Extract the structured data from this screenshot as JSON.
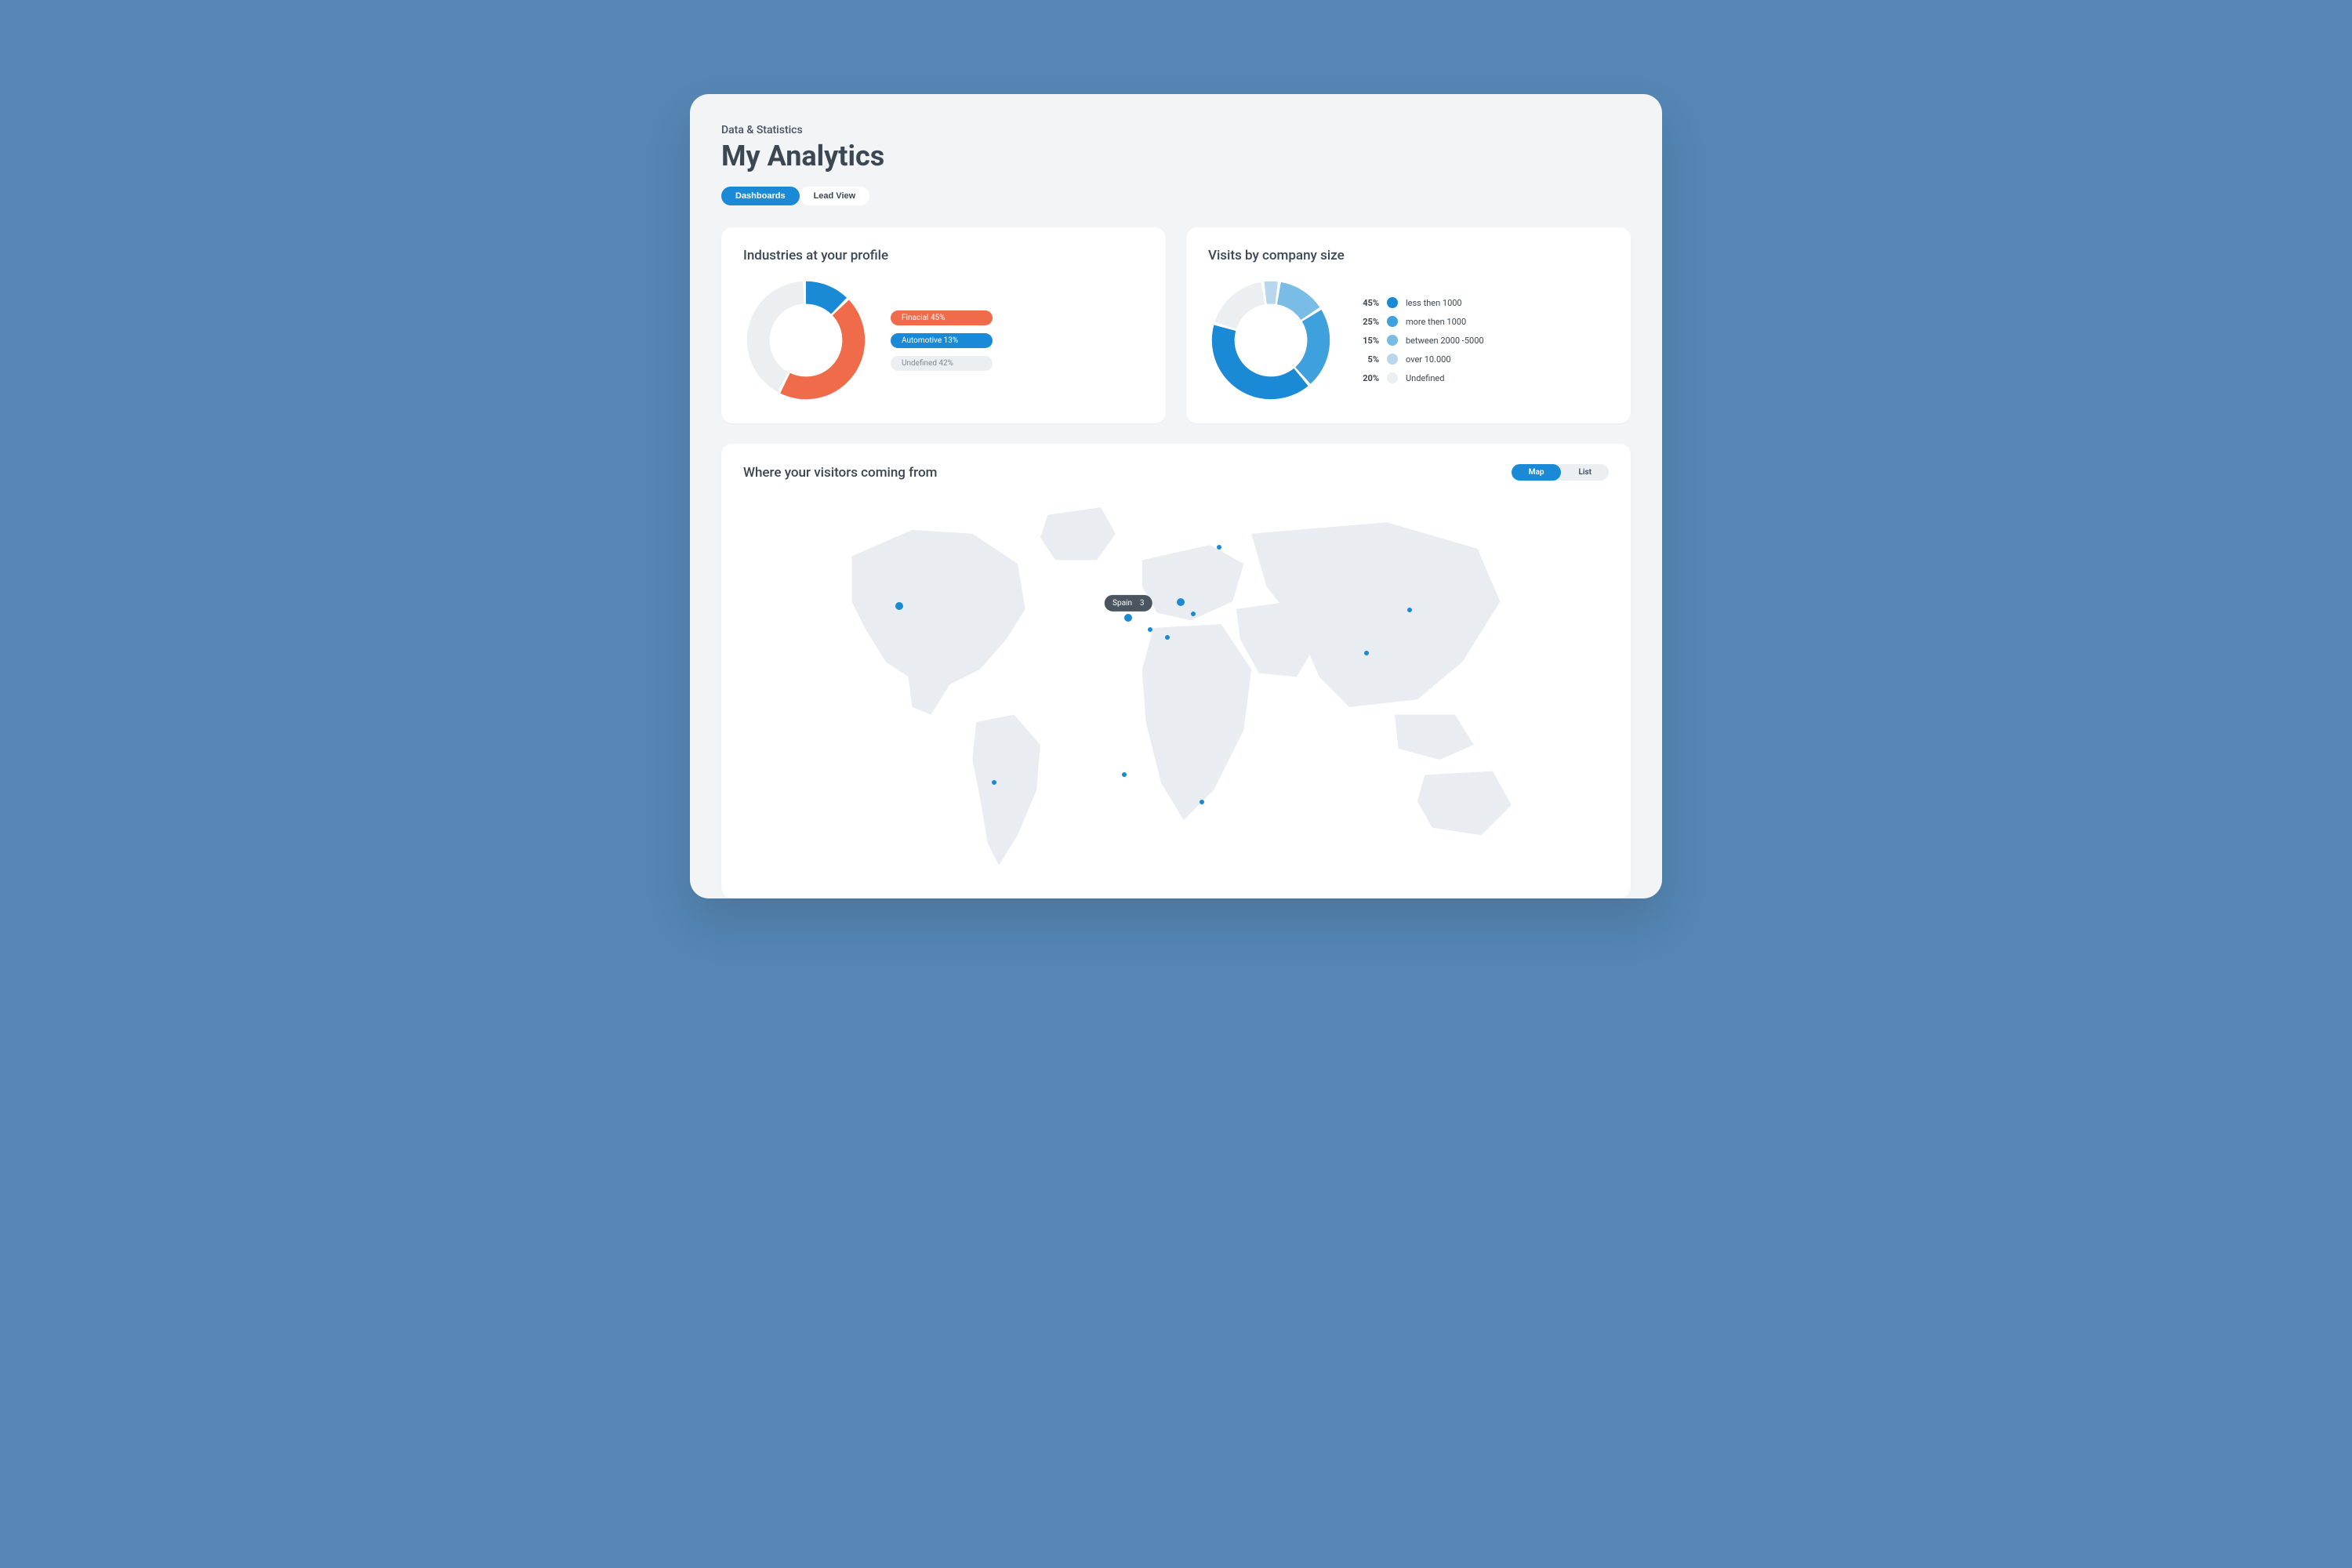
{
  "breadcrumb": "Data & Statistics",
  "title": "My Analytics",
  "tabs": {
    "dashboards": "Dashboards",
    "leadview": "Lead View"
  },
  "industries": {
    "title": "Industries at your profile",
    "items": [
      {
        "label": "Finacial 45%",
        "color": "#ef6b4a"
      },
      {
        "label": "Automotive 13%",
        "color": "#1a8ad6"
      },
      {
        "label": "Undefined 42%",
        "color": "grey"
      }
    ]
  },
  "company_size": {
    "title": "Visits by company size",
    "items": [
      {
        "pct": "45%",
        "label": "less then 1000",
        "color": "#1a8ad6"
      },
      {
        "pct": "25%",
        "label": "more then 1000",
        "color": "#3ea0dc"
      },
      {
        "pct": "15%",
        "label": "between 2000 -5000",
        "color": "#79bde6"
      },
      {
        "pct": "5%",
        "label": "over 10.000",
        "color": "#b7d8ec"
      },
      {
        "pct": "20%",
        "label": "Undefined",
        "color": "#eceff2"
      }
    ]
  },
  "map": {
    "title": "Where your visitors coming from",
    "tabs": {
      "map": "Map",
      "list": "List"
    },
    "tooltip_label": "Spain",
    "tooltip_value": "3"
  },
  "chart_data": [
    {
      "type": "pie",
      "title": "Industries at your profile",
      "series": [
        {
          "name": "Finacial",
          "value": 45,
          "color": "#ef6b4a"
        },
        {
          "name": "Automotive",
          "value": 13,
          "color": "#1a8ad6"
        },
        {
          "name": "Undefined",
          "value": 42,
          "color": "#eceff2"
        }
      ]
    },
    {
      "type": "pie",
      "title": "Visits by company size",
      "series": [
        {
          "name": "less then 1000",
          "value": 45,
          "color": "#1a8ad6"
        },
        {
          "name": "more then 1000",
          "value": 25,
          "color": "#3ea0dc"
        },
        {
          "name": "between 2000 -5000",
          "value": 15,
          "color": "#79bde6"
        },
        {
          "name": "over 10.000",
          "value": 5,
          "color": "#b7d8ec"
        },
        {
          "name": "Undefined",
          "value": 20,
          "color": "#eceff2"
        }
      ]
    }
  ]
}
